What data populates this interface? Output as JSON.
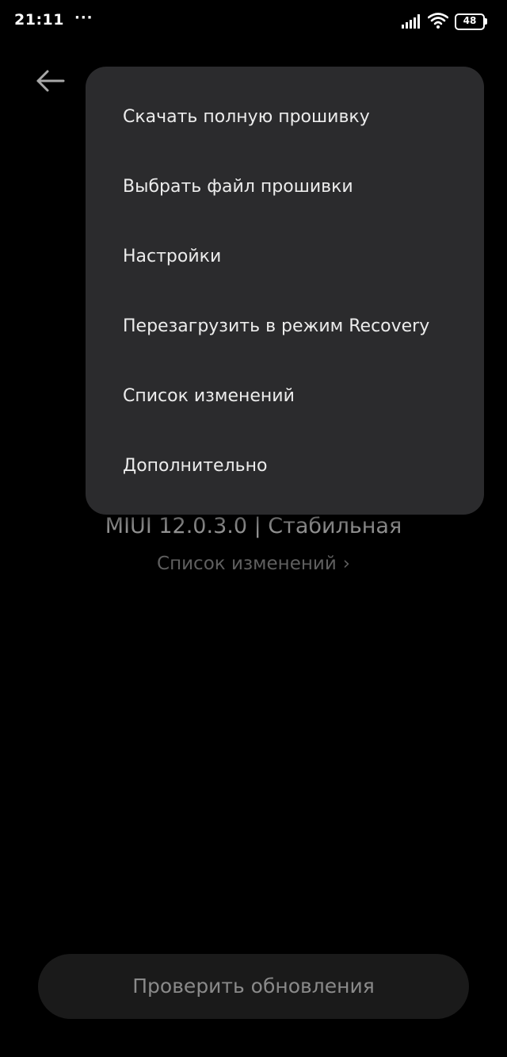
{
  "status_bar": {
    "time": "21:11",
    "more": "···",
    "icons": [
      "signal-icon",
      "wifi-icon",
      "battery-icon"
    ],
    "battery_level": "48"
  },
  "header": {
    "back_icon": "arrow-left-icon"
  },
  "main": {
    "version_title": "MIUI 12.0.3.0 | Стабильная",
    "changelog_link": "Список изменений",
    "changelog_chevron": "›",
    "check_button": "Проверить обновления"
  },
  "menu": {
    "items": [
      {
        "label": "Скачать полную прошивку"
      },
      {
        "label": "Выбрать файл прошивки"
      },
      {
        "label": "Настройки"
      },
      {
        "label": "Перезагрузить в режим Recovery"
      },
      {
        "label": "Список изменений"
      },
      {
        "label": "Дополнительно"
      }
    ]
  },
  "colors": {
    "background": "#000000",
    "menu_background": "#2b2b2d",
    "menu_text": "#ececec",
    "dimmed_text": "#9a9a9a",
    "button_background": "#1a1a1a"
  }
}
